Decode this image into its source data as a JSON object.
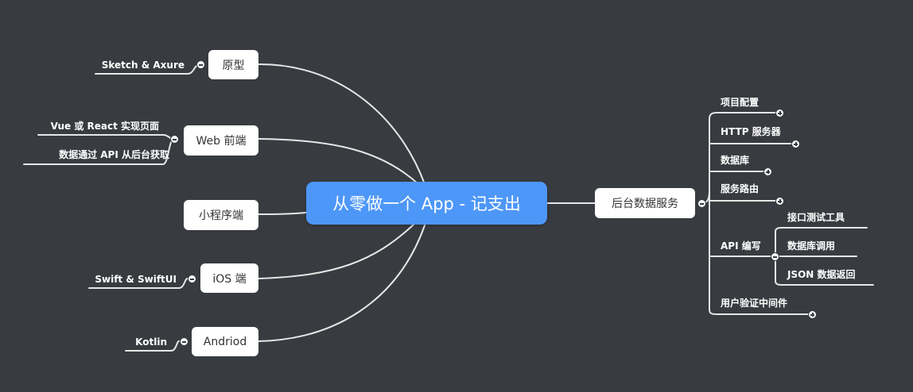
{
  "colors": {
    "background": "#383b40",
    "root": "#4d97f8",
    "node": "#ffffff",
    "line": "#e6e6e6"
  },
  "root": {
    "label": "从零做一个 App - 记支出"
  },
  "left_branches": {
    "prototype": {
      "label": "原型",
      "children": [
        "Sketch & Axure"
      ]
    },
    "web": {
      "label": "Web 前端",
      "children": [
        "Vue 或 React 实现页面",
        "数据通过 API 从后台获取"
      ]
    },
    "miniprogram": {
      "label": "小程序端",
      "children": []
    },
    "ios": {
      "label": "iOS 端",
      "children": [
        "Swift & SwiftUI"
      ]
    },
    "android": {
      "label": "Andriod",
      "children": [
        "Kotlin"
      ]
    }
  },
  "right_branch": {
    "label": "后台数据服务",
    "children": [
      {
        "label": "项目配置",
        "collapsed": true
      },
      {
        "label": "HTTP 服务器",
        "collapsed": true
      },
      {
        "label": "数据库",
        "collapsed": true
      },
      {
        "label": "服务路由",
        "collapsed": true
      },
      {
        "label": "API 编写",
        "collapsed": false,
        "children": [
          "接口测试工具",
          "数据库调用",
          "JSON 数据返回"
        ]
      },
      {
        "label": "用户验证中间件",
        "collapsed": true
      }
    ]
  }
}
